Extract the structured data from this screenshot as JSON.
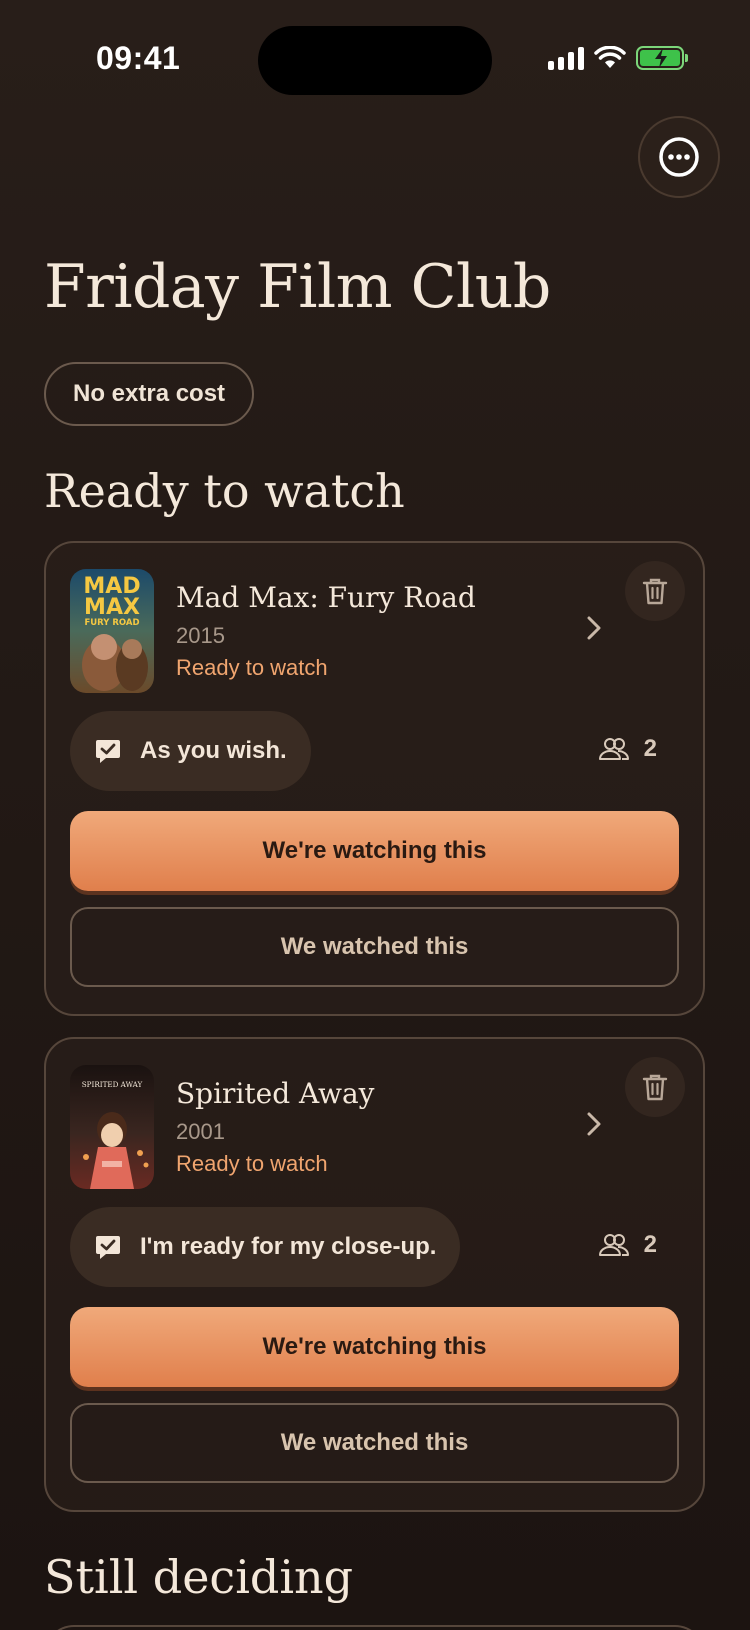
{
  "status_bar": {
    "time": "09:41"
  },
  "header": {
    "title": "Friday Film Club",
    "more_icon": "ellipsis-circle-icon"
  },
  "cost_pill": {
    "label": "No extra cost"
  },
  "sections": {
    "ready": {
      "title": "Ready to watch"
    },
    "deciding": {
      "title": "Still deciding"
    }
  },
  "movies": [
    {
      "title": "Mad Max: Fury Road",
      "year": "2015",
      "status": "Ready to watch",
      "quote": "As you wish.",
      "members": "2",
      "primary_action": "We're watching this",
      "secondary_action": "We watched this",
      "poster_text": [
        "MAD",
        "MAX",
        "FURY ROAD"
      ]
    },
    {
      "title": "Spirited Away",
      "year": "2001",
      "status": "Ready to watch",
      "quote": "I'm ready for my close-up.",
      "members": "2",
      "primary_action": "We're watching this",
      "secondary_action": "We watched this",
      "poster_text": [
        "SPIRITED AWAY"
      ]
    }
  ],
  "colors": {
    "accent": "#e88d5a",
    "status_text": "#f0a56f",
    "background": "#221915"
  }
}
